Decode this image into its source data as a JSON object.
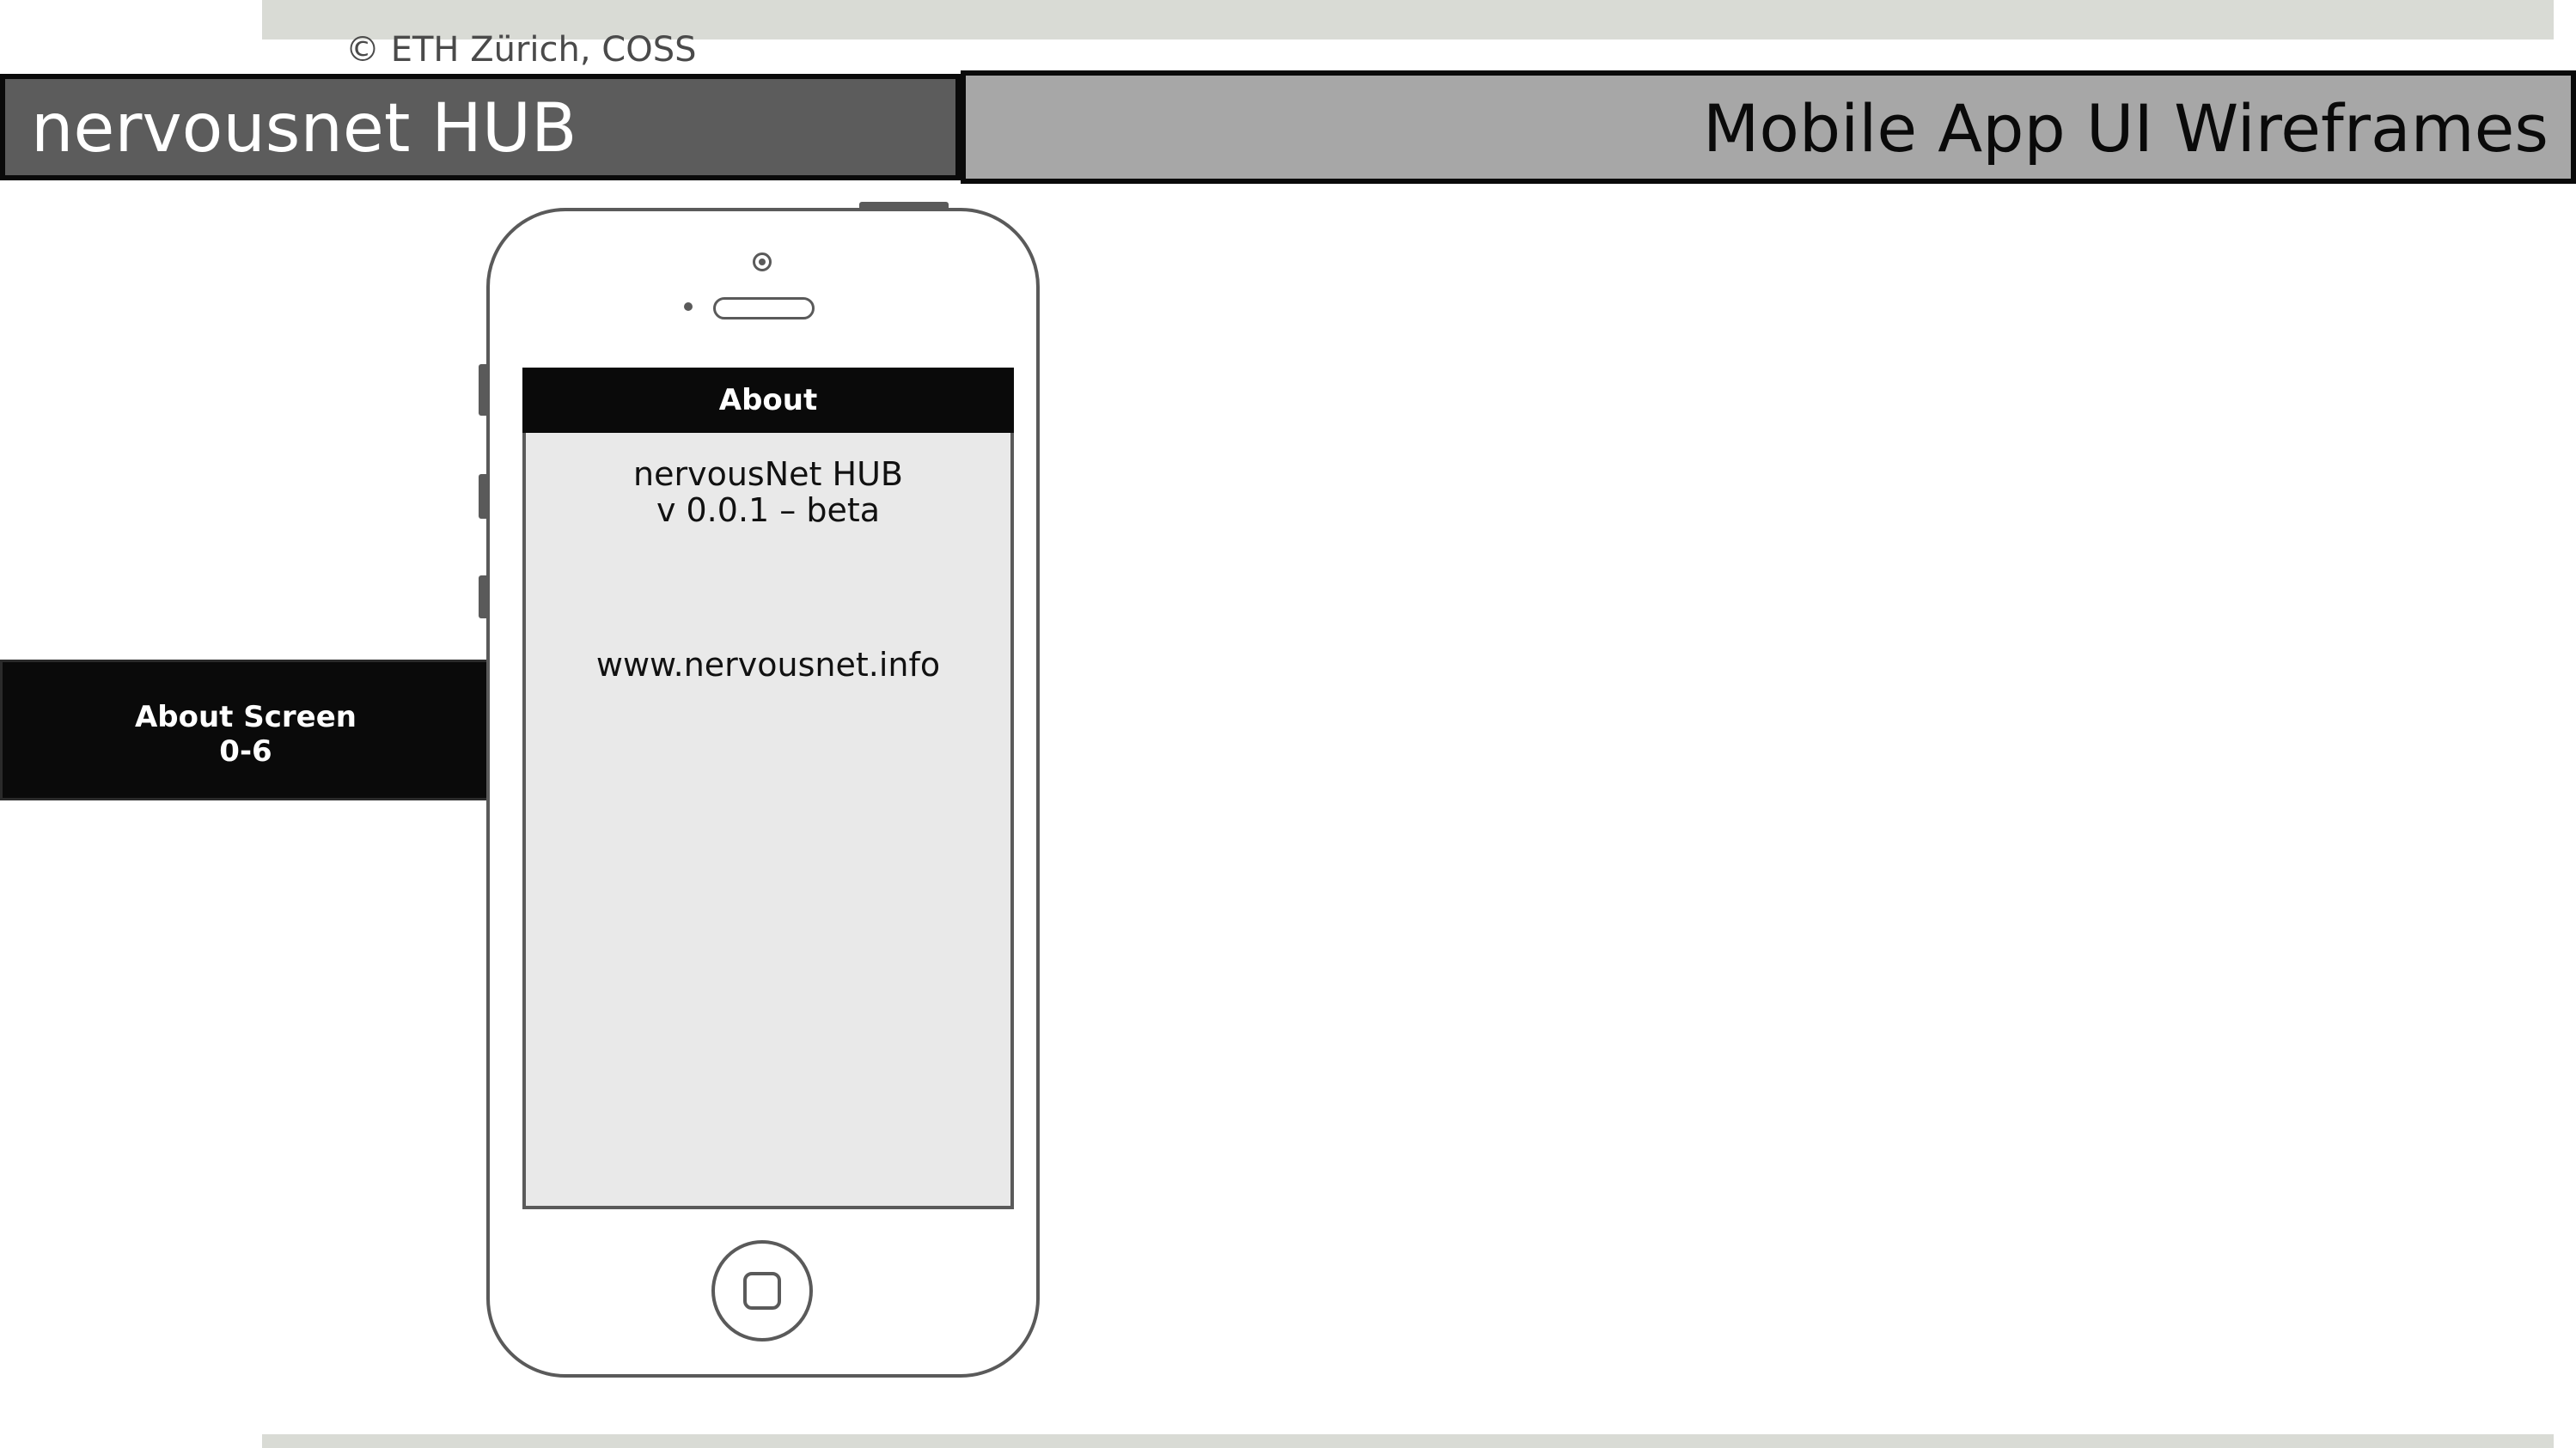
{
  "copyright": "© ETH Zürich, COSS",
  "header": {
    "left_title": "nervousnet HUB",
    "right_title": "Mobile App UI Wireframes"
  },
  "screen_label": {
    "name": "About Screen",
    "id": "0-6"
  },
  "app_screen": {
    "title": "About",
    "app_name": "nervousNet HUB",
    "version": "v 0.0.1 – beta",
    "website": "www.nervousnet.info"
  },
  "colors": {
    "band": "#d9dbd5",
    "header_left_bg": "#5c5c5c",
    "header_right_bg": "#a7a7a7",
    "label_bg": "#0a0a0a",
    "screen_bg": "#e9e9e9",
    "phone_outline": "#5a5a5a"
  },
  "icons": {
    "camera": "camera-icon",
    "speaker": "speaker-icon",
    "home": "home-button-icon"
  }
}
